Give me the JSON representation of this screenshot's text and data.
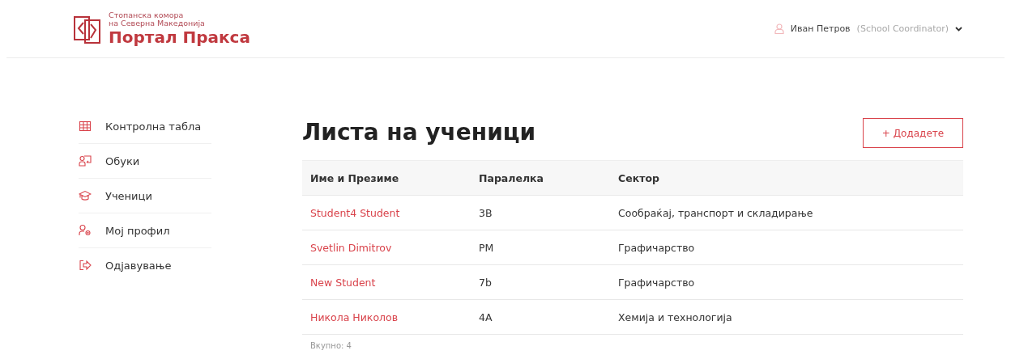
{
  "header": {
    "logo": {
      "org_line_1": "Стопанска комора",
      "org_line_2": "на Северна Македонија",
      "title": "Портал Пракса"
    },
    "user": {
      "name": "Иван Петров",
      "role": "(School Coordinator)"
    }
  },
  "sidebar": {
    "items": [
      {
        "label": "Контролна табла",
        "kind": "grid"
      },
      {
        "label": "Обуки",
        "kind": "training"
      },
      {
        "label": "Ученици",
        "kind": "cap"
      },
      {
        "label": "Мој профил",
        "kind": "profile"
      },
      {
        "label": "Одјавување",
        "kind": "logout"
      }
    ]
  },
  "page": {
    "title": "Листа на ученици",
    "add_button": "+ Додадете"
  },
  "table": {
    "columns": [
      "Име и Презиме",
      "Паралелка",
      "Сектор"
    ],
    "rows": [
      [
        "Student4 Student",
        "3B",
        "Сообраќај, транспорт и складирање"
      ],
      [
        "Svetlin Dimitrov",
        "PM",
        "Графичарство"
      ],
      [
        "New Student",
        "7b",
        "Графичарство"
      ],
      [
        "Никола Николов",
        "4A",
        "Хемија и технологија"
      ]
    ],
    "total": "Вкупно: 4"
  }
}
